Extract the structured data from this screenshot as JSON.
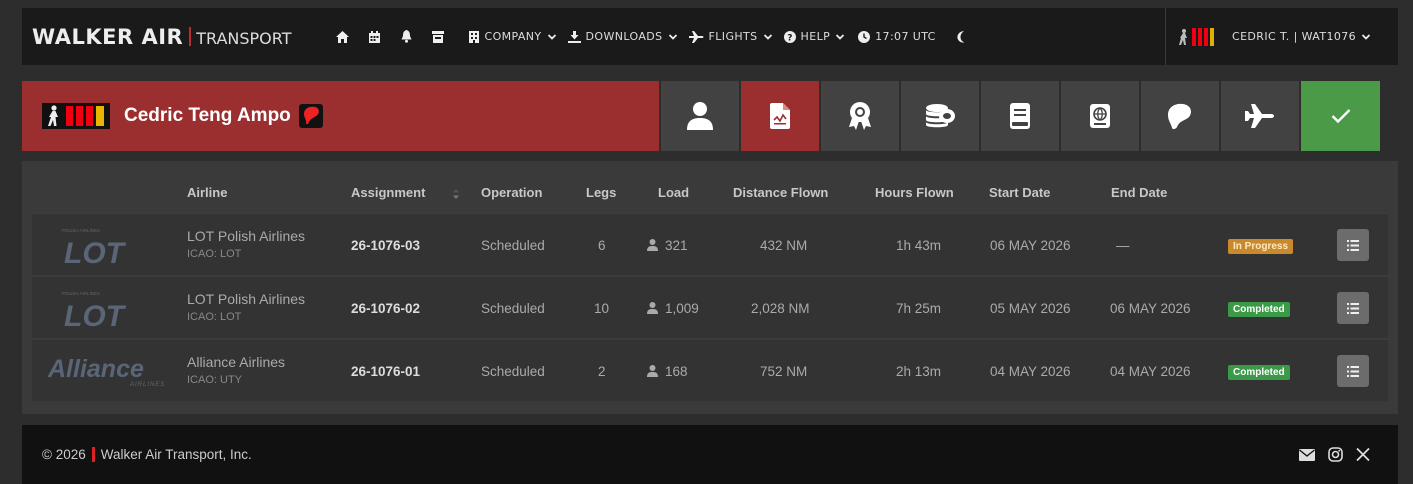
{
  "brand": {
    "main": "WALKER AIR",
    "sub": "TRANSPORT"
  },
  "nav": {
    "icons": [
      "home-icon",
      "calendar-icon",
      "bell-icon",
      "store-icon"
    ],
    "menus": [
      {
        "label": "COMPANY",
        "icon": "building-icon"
      },
      {
        "label": "DOWNLOADS",
        "icon": "download-icon"
      },
      {
        "label": "FLIGHTS",
        "icon": "plane-icon"
      },
      {
        "label": "HELP",
        "icon": "question-icon"
      }
    ],
    "clock": "17:07 UTC",
    "user": "CEDRIC T. | WAT1076"
  },
  "profile": {
    "name": "Cedric Teng Ampo",
    "tabs": [
      "user-icon",
      "document-chart-icon",
      "award-icon",
      "coins-icon",
      "book-icon",
      "passport-icon",
      "region-icon",
      "plane-icon",
      "check-icon"
    ],
    "active_tab": 1
  },
  "table": {
    "headers": [
      "Airline",
      "Assignment",
      "Operation",
      "Legs",
      "Load",
      "Distance Flown",
      "Hours Flown",
      "Start Date",
      "End Date"
    ],
    "rows": [
      {
        "logo": "LOT",
        "logo_tag": "POLISH AIRLINES",
        "airline": "LOT Polish Airlines",
        "icao": "ICAO: LOT",
        "assignment": "26-1076-03",
        "operation": "Scheduled",
        "legs": "6",
        "load": "321",
        "distance": "432 NM",
        "hours": "1h 43m",
        "start": "06 MAY 2026",
        "end": "—",
        "status": "In Progress"
      },
      {
        "logo": "LOT",
        "logo_tag": "POLISH AIRLINES",
        "airline": "LOT Polish Airlines",
        "icao": "ICAO: LOT",
        "assignment": "26-1076-02",
        "operation": "Scheduled",
        "legs": "10",
        "load": "1,009",
        "distance": "2,028 NM",
        "hours": "7h 25m",
        "start": "05 MAY 2026",
        "end": "06 MAY 2026",
        "status": "Completed"
      },
      {
        "logo": "Alliance",
        "logo_tag": "AIRLINES",
        "airline": "Alliance Airlines",
        "icao": "ICAO: UTY",
        "assignment": "26-1076-01",
        "operation": "Scheduled",
        "legs": "2",
        "load": "168",
        "distance": "752 NM",
        "hours": "2h 13m",
        "start": "04 MAY 2026",
        "end": "04 MAY 2026",
        "status": "Completed"
      }
    ]
  },
  "footer": {
    "year": "© 2026",
    "company": "Walker Air Transport, Inc."
  },
  "colors": {
    "accent": "#9b2f30",
    "success": "#4a9a48",
    "progress": "#c98a2e"
  }
}
